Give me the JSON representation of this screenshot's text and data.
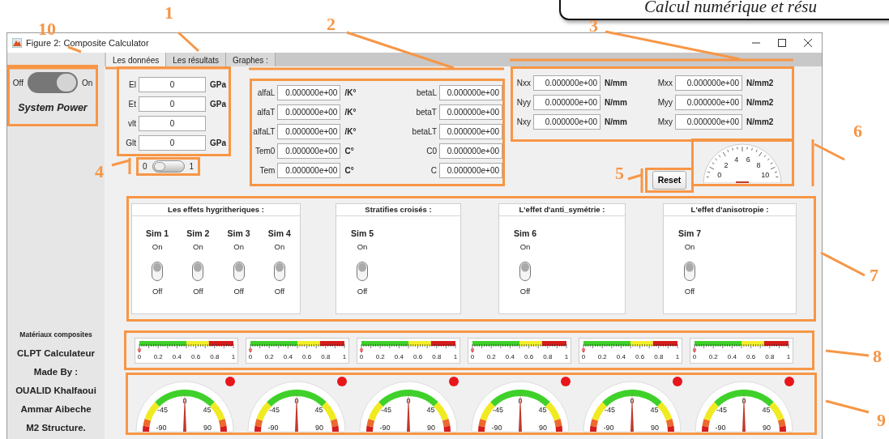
{
  "caption": {
    "text": "Calcul numérique et résu"
  },
  "window": {
    "title": "Figure 2: Composite Calculator"
  },
  "sidebar": {
    "power_switch": {
      "off_label": "Off",
      "on_label": "On",
      "on": true
    },
    "power_label": "System Power",
    "credits": [
      "Matériaux composites",
      "CLPT Calculateur",
      "Made By :",
      "OUALID Khalfaoui",
      "Ammar Aibeche",
      "M2 Structure."
    ]
  },
  "tabs": [
    {
      "label": "Les données",
      "selected": true
    },
    {
      "label": "Les résultats",
      "selected": false
    },
    {
      "label": "Graphes :",
      "selected": false
    }
  ],
  "material": [
    {
      "label": "El",
      "value": "0",
      "unit": "GPa"
    },
    {
      "label": "Et",
      "value": "0",
      "unit": "GPa"
    },
    {
      "label": "vlt",
      "value": "0"
    },
    {
      "label": "Glt",
      "value": "0",
      "unit": "GPa"
    }
  ],
  "mode_switch": {
    "off_label": "0",
    "on_label": "1",
    "on": false
  },
  "thermal": [
    {
      "label": "alfaL",
      "value": "0.000000e+00",
      "unit": "/K°",
      "label_2": "betaL",
      "value_2": "0.000000e+00"
    },
    {
      "label": "alfaT",
      "value": "0.000000e+00",
      "unit": "/K°",
      "label_2": "betaT",
      "value_2": "0.000000e+00"
    },
    {
      "label": "alfaLT",
      "value": "0.000000e+00",
      "unit": "/K°",
      "label_2": "betaLT",
      "value_2": "0.000000e+00"
    },
    {
      "label": "Tem0",
      "value": "0.000000e+00",
      "unit": "C°",
      "label_2": "C0",
      "value_2": "0.000000e+00"
    },
    {
      "label": "Tem",
      "value": "0.000000e+00",
      "unit": "C°",
      "label_2": "C",
      "value_2": "0.000000e+00"
    }
  ],
  "loads": [
    {
      "label": "Nxx",
      "value": "0.000000e+00",
      "unit": "N/mm",
      "label_2": "Mxx",
      "value_2": "0.000000e+00",
      "unit_2": "N/mm2"
    },
    {
      "label": "Nyy",
      "value": "0.000000e+00",
      "unit": "N/mm",
      "label_2": "Myy",
      "value_2": "0.000000e+00",
      "unit_2": "N/mm2"
    },
    {
      "label": "Nxy",
      "value": "0.000000e+00",
      "unit": "N/mm",
      "label_2": "Mxy",
      "value_2": "0.000000e+00",
      "unit_2": "N/mm2"
    }
  ],
  "reset_button": "Reset",
  "dial": {
    "ticks": [
      "0",
      "2",
      "4",
      "6",
      "8",
      "10"
    ]
  },
  "simulations": [
    {
      "title": "Les effets hygritheriques :",
      "switches": [
        {
          "name": "Sim 1",
          "on_label": "On",
          "off_label": "Off",
          "on": false
        },
        {
          "name": "Sim 2",
          "on_label": "On",
          "off_label": "Off",
          "on": false
        },
        {
          "name": "Sim 3",
          "on_label": "On",
          "off_label": "Off",
          "on": false
        },
        {
          "name": "Sim 4",
          "on_label": "On",
          "off_label": "Off",
          "on": false
        }
      ]
    },
    {
      "title": "Stratifies croisés :",
      "switches": [
        {
          "name": "Sim 5",
          "on_label": "On",
          "off_label": "Off",
          "on": false
        }
      ]
    },
    {
      "title": "L'effet d'anti_symétrie :",
      "switches": [
        {
          "name": "Sim 6",
          "on_label": "On",
          "off_label": "Off",
          "on": false
        }
      ]
    },
    {
      "title": "L'effet d'anisotropie :",
      "switches": [
        {
          "name": "Sim 7",
          "on_label": "On",
          "off_label": "Off",
          "on": false
        }
      ]
    }
  ],
  "meters": [
    {
      "ticks": [
        "0",
        "0.2",
        "0.4",
        "0.6",
        "0.8",
        "1"
      ]
    },
    {
      "ticks": [
        "0",
        "0.2",
        "0.4",
        "0.6",
        "0.8",
        "1"
      ]
    },
    {
      "ticks": [
        "0",
        "0.2",
        "0.4",
        "0.6",
        "0.8",
        "1"
      ]
    },
    {
      "ticks": [
        "0",
        "0.2",
        "0.4",
        "0.6",
        "0.8",
        "1"
      ]
    },
    {
      "ticks": [
        "0",
        "0.2",
        "0.4",
        "0.6",
        "0.8",
        "1"
      ]
    },
    {
      "ticks": [
        "0",
        "0.2",
        "0.4",
        "0.6",
        "0.8",
        "1"
      ]
    }
  ],
  "gauges": [
    {
      "ticks": [
        "-90",
        "-45",
        "0",
        "45",
        "90"
      ],
      "color": "#e8161b"
    },
    {
      "ticks": [
        "-90",
        "-45",
        "0",
        "45",
        "90"
      ],
      "color": "#e8161b"
    },
    {
      "ticks": [
        "-90",
        "-45",
        "0",
        "45",
        "90"
      ],
      "color": "#e8161b"
    },
    {
      "ticks": [
        "-90",
        "-45",
        "0",
        "45",
        "90"
      ],
      "color": "#e8161b"
    },
    {
      "ticks": [
        "-90",
        "-45",
        "0",
        "45",
        "90"
      ],
      "color": "#e8161b"
    },
    {
      "ticks": [
        "-90",
        "-45",
        "0",
        "45",
        "90"
      ],
      "color": "#e8161b"
    }
  ],
  "annotations": [
    "10",
    "1",
    "2",
    "3",
    "4",
    "5",
    "6",
    "7",
    "8",
    "9"
  ]
}
